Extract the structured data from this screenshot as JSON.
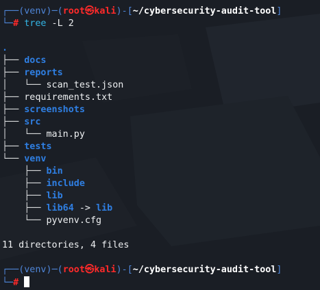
{
  "prompt": {
    "venv": "(venv)",
    "user": "root",
    "at_symbol": "㉿",
    "host": "kali",
    "path": "~/cybersecurity-audit-tool"
  },
  "command": {
    "name": "tree",
    "args": " -L 2"
  },
  "tree": {
    "root": ".",
    "entries": [
      {
        "prefix": "├── ",
        "name": "docs"
      },
      {
        "prefix": "├── ",
        "name": "reports"
      },
      {
        "prefix": "│   └── ",
        "name": "scan_test.json"
      },
      {
        "prefix": "├── ",
        "name": "requirements.txt"
      },
      {
        "prefix": "├── ",
        "name": "screenshots"
      },
      {
        "prefix": "├── ",
        "name": "src"
      },
      {
        "prefix": "│   └── ",
        "name": "main.py"
      },
      {
        "prefix": "├── ",
        "name": "tests"
      },
      {
        "prefix": "└── ",
        "name": "venv"
      },
      {
        "prefix": "    ├── ",
        "name": "bin"
      },
      {
        "prefix": "    ├── ",
        "name": "include"
      },
      {
        "prefix": "    ├── ",
        "name": "lib"
      },
      {
        "prefix": "    ├── ",
        "name": "lib64"
      },
      {
        "prefix": "    └── ",
        "name": "pyvenv.cfg"
      }
    ],
    "symlink_arrow": " -> ",
    "symlink_target": "lib",
    "summary": "11 directories, 4 files"
  },
  "colors": {
    "background": "#1a1e25",
    "prompt_frame": "#4f86d9",
    "user_host": "#ff2a2a",
    "directory": "#2f7fe3",
    "command": "#33b5e5"
  }
}
